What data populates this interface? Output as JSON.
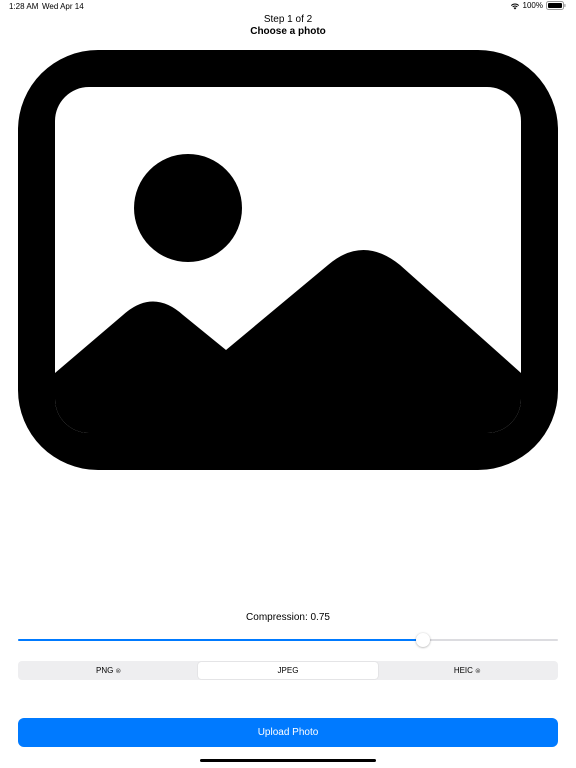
{
  "status_bar": {
    "time": "1:28 AM",
    "date": "Wed Apr 14",
    "battery": "100%",
    "wifi_icon": "wifi-icon",
    "battery_icon": "battery-icon"
  },
  "header": {
    "step": "Step 1 of 2",
    "title": "Choose a photo"
  },
  "placeholder": {
    "icon": "photo-icon"
  },
  "compression": {
    "label": "Compression: 0.75",
    "value": 0.75
  },
  "format_picker": {
    "options": [
      {
        "label": "PNG",
        "badge": "⊗",
        "selected": false
      },
      {
        "label": "JPEG",
        "badge": "",
        "selected": true
      },
      {
        "label": "HEIC",
        "badge": "⊗",
        "selected": false
      }
    ]
  },
  "upload_button": {
    "label": "Upload Photo"
  },
  "colors": {
    "accent": "#007aff",
    "segment_bg": "#eeeef0"
  }
}
